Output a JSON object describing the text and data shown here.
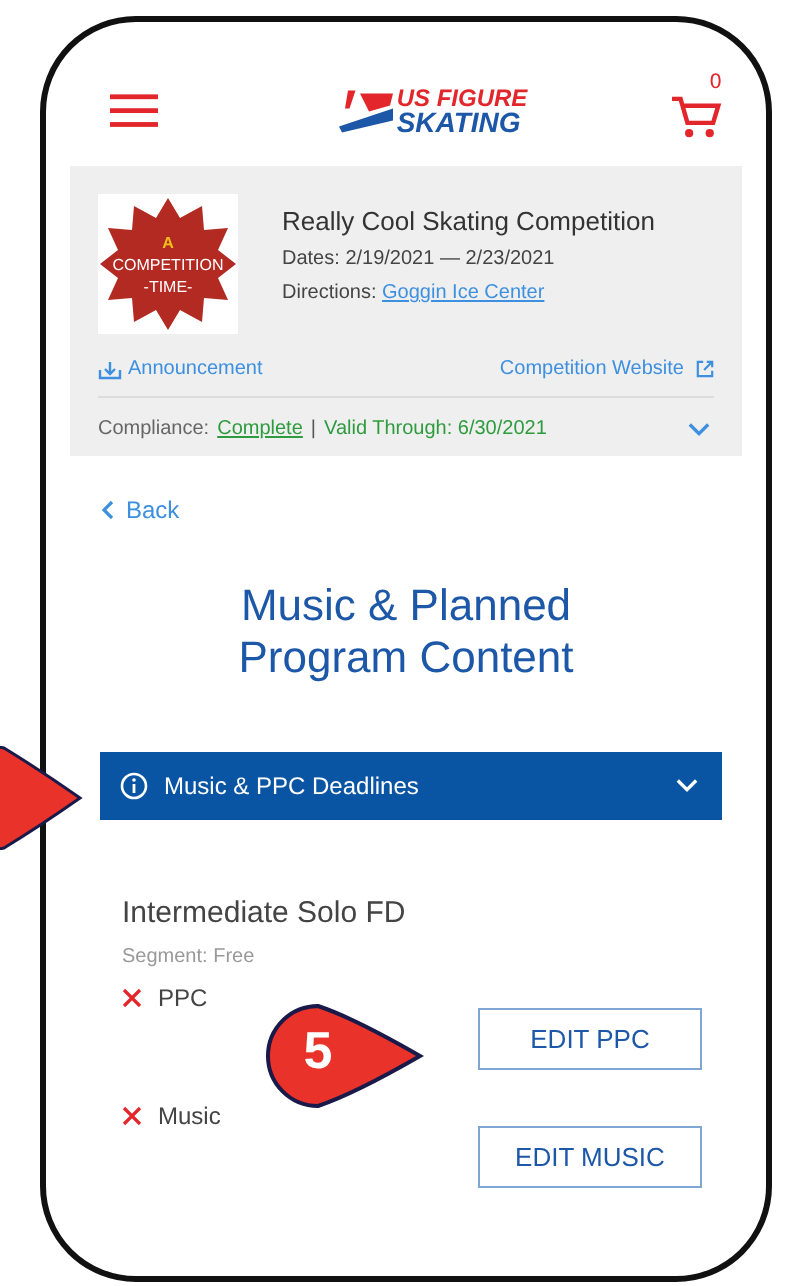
{
  "header": {
    "logo_lines": [
      "US FIGURE",
      "SKATING"
    ],
    "cart_count": "0"
  },
  "competition": {
    "title": "Really Cool Skating Competition",
    "image_caption_lines": [
      "A",
      "COMPETITION",
      "-TIME-"
    ],
    "dates_label": "Dates:",
    "dates": "2/19/2021 — 2/23/2021",
    "directions_label": "Directions:",
    "directions_link": "Goggin Ice Center",
    "announcement_link": "Announcement",
    "website_link": "Competition Website",
    "compliance_label": "Compliance:",
    "compliance_status": "Complete",
    "separator": "|",
    "valid_through": "Valid Through: 6/30/2021",
    "expanded": false
  },
  "back_link": "Back",
  "page_title": "Music & Planned Program Content",
  "deadlines_bar": {
    "label": "Music & PPC Deadlines",
    "expanded": false
  },
  "event": {
    "name": "Intermediate Solo FD",
    "segment": "Segment: Free",
    "requirements": [
      {
        "label": "PPC",
        "complete": false,
        "button": "EDIT PPC"
      },
      {
        "label": "Music",
        "complete": false,
        "button": "EDIT MUSIC"
      }
    ]
  },
  "callouts": [
    {
      "number": "5"
    }
  ]
}
